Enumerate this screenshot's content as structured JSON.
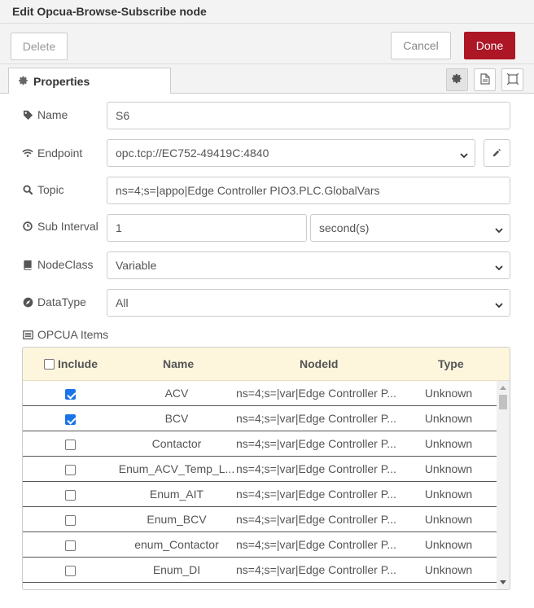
{
  "dialog": {
    "title": "Edit Opcua-Browse-Subscribe node"
  },
  "toolbar": {
    "delete_label": "Delete",
    "cancel_label": "Cancel",
    "done_label": "Done"
  },
  "tabs": [
    {
      "label": "Properties",
      "icon": "gear-icon",
      "active": true
    }
  ],
  "tab_tools": [
    "gear-icon",
    "document-icon",
    "expand-icon"
  ],
  "form": {
    "name": {
      "label": "Name",
      "icon": "tag-icon",
      "value": "S6"
    },
    "endpoint": {
      "label": "Endpoint",
      "icon": "wifi-icon",
      "value": "opc.tcp://EC752-49419C:4840",
      "edit_icon": "pencil-icon"
    },
    "topic": {
      "label": "Topic",
      "icon": "search-icon",
      "value": "ns=4;s=|appo|Edge Controller PIO3.PLC.GlobalVars"
    },
    "sub_interval": {
      "label": "Sub Interval",
      "icon": "clock-icon",
      "value": "1",
      "unit": "second(s)"
    },
    "nodeclass": {
      "label": "NodeClass",
      "icon": "book-icon",
      "value": "Variable"
    },
    "datatype": {
      "label": "DataType",
      "icon": "compass-icon",
      "value": "All"
    }
  },
  "items": {
    "label": "OPCUA Items",
    "icon": "list-icon",
    "columns": {
      "include": "Include",
      "name": "Name",
      "nodeid": "NodeId",
      "type": "Type"
    },
    "rows": [
      {
        "checked": true,
        "name": "ACV",
        "nodeid": "ns=4;s=|var|Edge Controller P...",
        "type": "Unknown"
      },
      {
        "checked": true,
        "name": "BCV",
        "nodeid": "ns=4;s=|var|Edge Controller P...",
        "type": "Unknown"
      },
      {
        "checked": false,
        "name": "Contactor",
        "nodeid": "ns=4;s=|var|Edge Controller P...",
        "type": "Unknown"
      },
      {
        "checked": false,
        "name": "Enum_ACV_Temp_L...",
        "nodeid": "ns=4;s=|var|Edge Controller P...",
        "type": "Unknown"
      },
      {
        "checked": false,
        "name": "Enum_AIT",
        "nodeid": "ns=4;s=|var|Edge Controller P...",
        "type": "Unknown"
      },
      {
        "checked": false,
        "name": "Enum_BCV",
        "nodeid": "ns=4;s=|var|Edge Controller P...",
        "type": "Unknown"
      },
      {
        "checked": false,
        "name": "enum_Contactor",
        "nodeid": "ns=4;s=|var|Edge Controller P...",
        "type": "Unknown"
      },
      {
        "checked": false,
        "name": "Enum_DI",
        "nodeid": "ns=4;s=|var|Edge Controller P...",
        "type": "Unknown"
      }
    ]
  },
  "colors": {
    "done_button": "#ad1625",
    "table_header": "#fdf6dd",
    "checkbox_checked": "#1a73e8"
  }
}
